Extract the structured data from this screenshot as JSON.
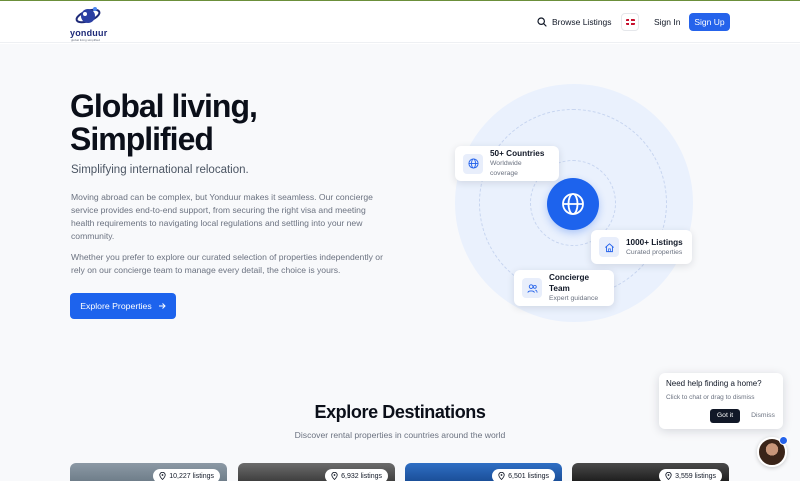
{
  "brand": {
    "name": "yonduur",
    "tagline": "global living simplified",
    "accent": "#2563eb"
  },
  "nav": {
    "browse_label": "Browse Listings",
    "signin_label": "Sign In",
    "signup_label": "Sign Up"
  },
  "hero": {
    "title_line1": "Global living,",
    "title_line2": "Simplified",
    "subtitle": "Simplifying international relocation.",
    "paragraph1": "Moving abroad can be complex, but Yonduur makes it seamless. Our concierge service provides end-to-end support, from securing the right visa and meeting health requirements to navigating local regulations and settling into your new community.",
    "paragraph2": "Whether you prefer to explore our curated selection of properties independently or rely on our concierge team to manage every detail, the choice is yours.",
    "cta_label": "Explore Properties"
  },
  "stats": [
    {
      "title": "50+ Countries",
      "subtitle": "Worldwide coverage",
      "icon": "globe-icon"
    },
    {
      "title": "1000+ Listings",
      "subtitle": "Curated properties",
      "icon": "home-icon"
    },
    {
      "title": "Concierge Team",
      "subtitle": "Expert guidance",
      "icon": "users-icon"
    }
  ],
  "destinations": {
    "title": "Explore Destinations",
    "subtitle": "Discover rental properties in countries around the world",
    "cards": [
      {
        "listings": "10,227 listings"
      },
      {
        "listings": "6,932 listings"
      },
      {
        "listings": "6,501 listings"
      },
      {
        "listings": "3,559 listings"
      }
    ]
  },
  "chat": {
    "question": "Need help finding a home?",
    "hint": "Click to chat or drag to dismiss",
    "gotit_label": "Got it",
    "dismiss_label": "Dismiss"
  }
}
